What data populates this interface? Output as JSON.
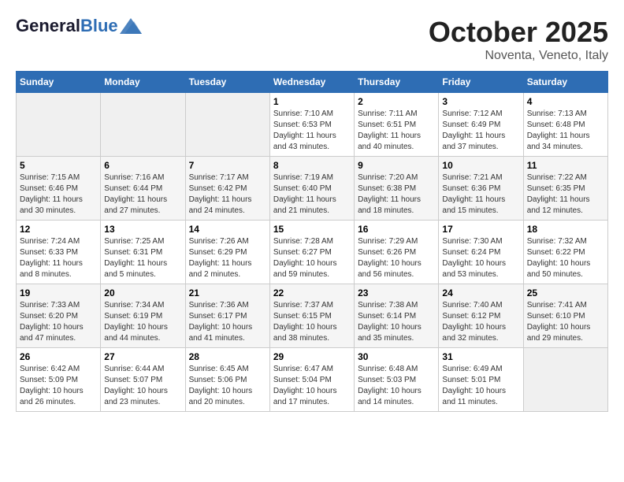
{
  "header": {
    "logo_general": "General",
    "logo_blue": "Blue",
    "month": "October 2025",
    "location": "Noventa, Veneto, Italy"
  },
  "weekdays": [
    "Sunday",
    "Monday",
    "Tuesday",
    "Wednesday",
    "Thursday",
    "Friday",
    "Saturday"
  ],
  "weeks": [
    [
      {
        "day": "",
        "sunrise": "",
        "sunset": "",
        "daylight": ""
      },
      {
        "day": "",
        "sunrise": "",
        "sunset": "",
        "daylight": ""
      },
      {
        "day": "",
        "sunrise": "",
        "sunset": "",
        "daylight": ""
      },
      {
        "day": "1",
        "sunrise": "Sunrise: 7:10 AM",
        "sunset": "Sunset: 6:53 PM",
        "daylight": "Daylight: 11 hours and 43 minutes."
      },
      {
        "day": "2",
        "sunrise": "Sunrise: 7:11 AM",
        "sunset": "Sunset: 6:51 PM",
        "daylight": "Daylight: 11 hours and 40 minutes."
      },
      {
        "day": "3",
        "sunrise": "Sunrise: 7:12 AM",
        "sunset": "Sunset: 6:49 PM",
        "daylight": "Daylight: 11 hours and 37 minutes."
      },
      {
        "day": "4",
        "sunrise": "Sunrise: 7:13 AM",
        "sunset": "Sunset: 6:48 PM",
        "daylight": "Daylight: 11 hours and 34 minutes."
      }
    ],
    [
      {
        "day": "5",
        "sunrise": "Sunrise: 7:15 AM",
        "sunset": "Sunset: 6:46 PM",
        "daylight": "Daylight: 11 hours and 30 minutes."
      },
      {
        "day": "6",
        "sunrise": "Sunrise: 7:16 AM",
        "sunset": "Sunset: 6:44 PM",
        "daylight": "Daylight: 11 hours and 27 minutes."
      },
      {
        "day": "7",
        "sunrise": "Sunrise: 7:17 AM",
        "sunset": "Sunset: 6:42 PM",
        "daylight": "Daylight: 11 hours and 24 minutes."
      },
      {
        "day": "8",
        "sunrise": "Sunrise: 7:19 AM",
        "sunset": "Sunset: 6:40 PM",
        "daylight": "Daylight: 11 hours and 21 minutes."
      },
      {
        "day": "9",
        "sunrise": "Sunrise: 7:20 AM",
        "sunset": "Sunset: 6:38 PM",
        "daylight": "Daylight: 11 hours and 18 minutes."
      },
      {
        "day": "10",
        "sunrise": "Sunrise: 7:21 AM",
        "sunset": "Sunset: 6:36 PM",
        "daylight": "Daylight: 11 hours and 15 minutes."
      },
      {
        "day": "11",
        "sunrise": "Sunrise: 7:22 AM",
        "sunset": "Sunset: 6:35 PM",
        "daylight": "Daylight: 11 hours and 12 minutes."
      }
    ],
    [
      {
        "day": "12",
        "sunrise": "Sunrise: 7:24 AM",
        "sunset": "Sunset: 6:33 PM",
        "daylight": "Daylight: 11 hours and 8 minutes."
      },
      {
        "day": "13",
        "sunrise": "Sunrise: 7:25 AM",
        "sunset": "Sunset: 6:31 PM",
        "daylight": "Daylight: 11 hours and 5 minutes."
      },
      {
        "day": "14",
        "sunrise": "Sunrise: 7:26 AM",
        "sunset": "Sunset: 6:29 PM",
        "daylight": "Daylight: 11 hours and 2 minutes."
      },
      {
        "day": "15",
        "sunrise": "Sunrise: 7:28 AM",
        "sunset": "Sunset: 6:27 PM",
        "daylight": "Daylight: 10 hours and 59 minutes."
      },
      {
        "day": "16",
        "sunrise": "Sunrise: 7:29 AM",
        "sunset": "Sunset: 6:26 PM",
        "daylight": "Daylight: 10 hours and 56 minutes."
      },
      {
        "day": "17",
        "sunrise": "Sunrise: 7:30 AM",
        "sunset": "Sunset: 6:24 PM",
        "daylight": "Daylight: 10 hours and 53 minutes."
      },
      {
        "day": "18",
        "sunrise": "Sunrise: 7:32 AM",
        "sunset": "Sunset: 6:22 PM",
        "daylight": "Daylight: 10 hours and 50 minutes."
      }
    ],
    [
      {
        "day": "19",
        "sunrise": "Sunrise: 7:33 AM",
        "sunset": "Sunset: 6:20 PM",
        "daylight": "Daylight: 10 hours and 47 minutes."
      },
      {
        "day": "20",
        "sunrise": "Sunrise: 7:34 AM",
        "sunset": "Sunset: 6:19 PM",
        "daylight": "Daylight: 10 hours and 44 minutes."
      },
      {
        "day": "21",
        "sunrise": "Sunrise: 7:36 AM",
        "sunset": "Sunset: 6:17 PM",
        "daylight": "Daylight: 10 hours and 41 minutes."
      },
      {
        "day": "22",
        "sunrise": "Sunrise: 7:37 AM",
        "sunset": "Sunset: 6:15 PM",
        "daylight": "Daylight: 10 hours and 38 minutes."
      },
      {
        "day": "23",
        "sunrise": "Sunrise: 7:38 AM",
        "sunset": "Sunset: 6:14 PM",
        "daylight": "Daylight: 10 hours and 35 minutes."
      },
      {
        "day": "24",
        "sunrise": "Sunrise: 7:40 AM",
        "sunset": "Sunset: 6:12 PM",
        "daylight": "Daylight: 10 hours and 32 minutes."
      },
      {
        "day": "25",
        "sunrise": "Sunrise: 7:41 AM",
        "sunset": "Sunset: 6:10 PM",
        "daylight": "Daylight: 10 hours and 29 minutes."
      }
    ],
    [
      {
        "day": "26",
        "sunrise": "Sunrise: 6:42 AM",
        "sunset": "Sunset: 5:09 PM",
        "daylight": "Daylight: 10 hours and 26 minutes."
      },
      {
        "day": "27",
        "sunrise": "Sunrise: 6:44 AM",
        "sunset": "Sunset: 5:07 PM",
        "daylight": "Daylight: 10 hours and 23 minutes."
      },
      {
        "day": "28",
        "sunrise": "Sunrise: 6:45 AM",
        "sunset": "Sunset: 5:06 PM",
        "daylight": "Daylight: 10 hours and 20 minutes."
      },
      {
        "day": "29",
        "sunrise": "Sunrise: 6:47 AM",
        "sunset": "Sunset: 5:04 PM",
        "daylight": "Daylight: 10 hours and 17 minutes."
      },
      {
        "day": "30",
        "sunrise": "Sunrise: 6:48 AM",
        "sunset": "Sunset: 5:03 PM",
        "daylight": "Daylight: 10 hours and 14 minutes."
      },
      {
        "day": "31",
        "sunrise": "Sunrise: 6:49 AM",
        "sunset": "Sunset: 5:01 PM",
        "daylight": "Daylight: 10 hours and 11 minutes."
      },
      {
        "day": "",
        "sunrise": "",
        "sunset": "",
        "daylight": ""
      }
    ]
  ]
}
